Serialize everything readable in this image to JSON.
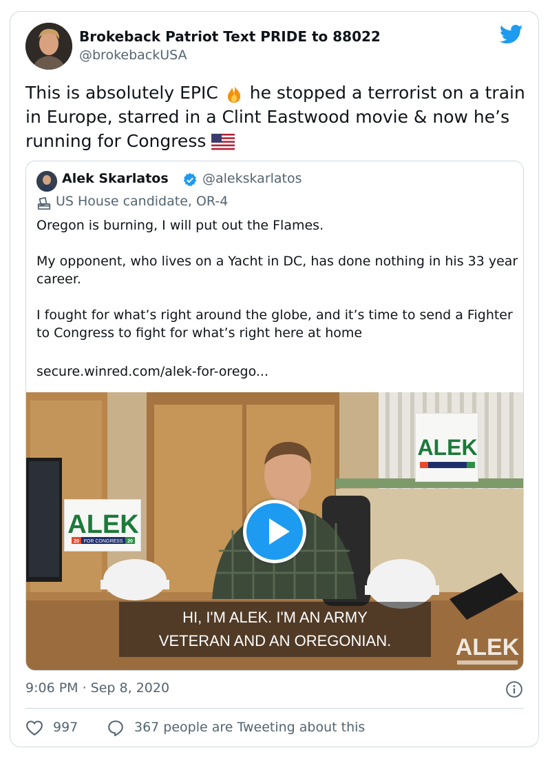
{
  "tweet": {
    "author_name": "Brokeback Patriot Text PRIDE to 88022",
    "author_handle": "@brokebackUSA",
    "text_part1": "This is absolutely EPIC ",
    "text_part2": " he stopped a terrorist on a train in Europe, starred in a Clint Eastwood movie & now he’s running for Congress ",
    "emoji_1": "fire-emoji",
    "emoji_2": "us-flag-emoji",
    "timestamp": "9:06 PM · Sep 8, 2020",
    "like_count": "997",
    "reply_text": "367 people are Tweeting about this"
  },
  "quote": {
    "author_name": "Alek Skarlatos",
    "author_handle": "@alekskarlatos",
    "label": "US House candidate, OR-4",
    "body": [
      "Oregon is burning, I will put out the Flames.",
      "My opponent, who lives on a Yacht in DC, has done nothing in his 33 year career.",
      "I fought for what’s right around the globe, and it’s time to send a Fighter to Congress to fight for what’s right here at home"
    ],
    "link": "secure.winred.com/alek-for-orego...",
    "video": {
      "subtitle_line1": "HI, I'M ALEK. I'M AN ARMY",
      "subtitle_line2": "VETERAN AND AN OREGONIAN.",
      "sign_text": "ALEK",
      "sign_sub": "FOR CONGRESS",
      "sign_year_a": "20",
      "sign_year_b": "20"
    }
  },
  "colors": {
    "twitter_blue": "#1d9bf0",
    "text_secondary": "#536471",
    "border": "#cfd9de"
  }
}
